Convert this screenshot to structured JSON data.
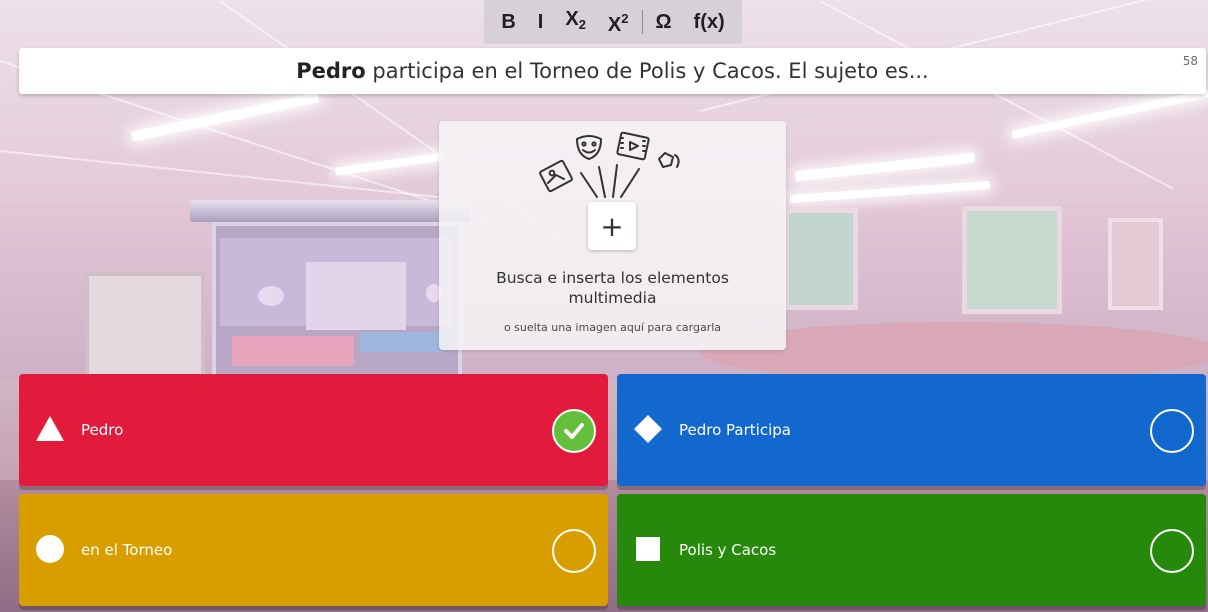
{
  "toolbar": {
    "bold": "B",
    "italic": "I",
    "subscript": "X",
    "subscript_index": "2",
    "superscript": "X",
    "superscript_index": "2",
    "symbol": "Ω",
    "formula": "f(x)"
  },
  "question": {
    "bold_part": "Pedro",
    "rest": " participa en el Torneo de Polis y Cacos. El sujeto es...",
    "char_count": "58"
  },
  "media": {
    "add_icon": "+",
    "title_line1": "Busca e inserta los elementos",
    "title_line2": "multimedia",
    "hint": "o suelta una imagen aquí para cargarla",
    "illustration_icons": [
      "image-icon",
      "mask-icon",
      "video-icon",
      "audio-icon"
    ]
  },
  "answers": [
    {
      "text": "Pedro",
      "shape": "triangle-icon",
      "color": "#e21b3c",
      "correct": true
    },
    {
      "text": "Pedro Participa",
      "shape": "diamond-icon",
      "color": "#1368ce",
      "correct": false
    },
    {
      "text": "en el Torneo",
      "shape": "circle-icon",
      "color": "#d89e00",
      "correct": false
    },
    {
      "text": "Polis y Cacos",
      "shape": "square-icon",
      "color": "#26890c",
      "correct": false
    }
  ],
  "colors": {
    "correct_check": "#66bf3c"
  }
}
